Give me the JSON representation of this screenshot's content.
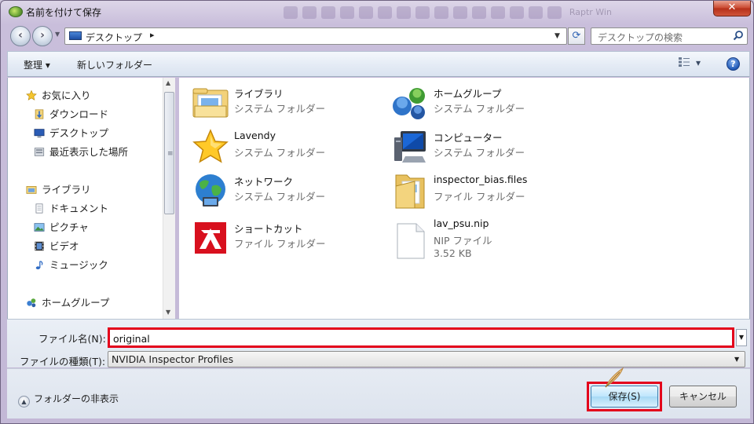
{
  "window": {
    "title": "名前を付けて保存",
    "close_label": "✕",
    "background_tabs": "Raptr Win"
  },
  "address": {
    "current": "デスクトップ",
    "separator": "▸",
    "search_placeholder": "デスクトップの検索"
  },
  "toolbar": {
    "organize": "整理 ▾",
    "new_folder": "新しいフォルダー",
    "view": "▾",
    "help": "?"
  },
  "nav": {
    "favorites": "お気に入り",
    "downloads": "ダウンロード",
    "desktop": "デスクトップ",
    "recent": "最近表示した場所",
    "libraries": "ライブラリ",
    "documents": "ドキュメント",
    "pictures": "ピクチャ",
    "videos": "ビデオ",
    "music": "ミュージック",
    "homegroup": "ホームグループ"
  },
  "files": [
    {
      "name": "ライブラリ",
      "type": "システム フォルダー",
      "icon": "library-folder-icon"
    },
    {
      "name": "ホームグループ",
      "type": "システム フォルダー",
      "icon": "homegroup-icon"
    },
    {
      "name": "Lavendy",
      "type": "システム フォルダー",
      "icon": "user-star-icon"
    },
    {
      "name": "コンピューター",
      "type": "システム フォルダー",
      "icon": "computer-icon"
    },
    {
      "name": "ネットワーク",
      "type": "システム フォルダー",
      "icon": "network-globe-icon"
    },
    {
      "name": "inspector_bias.files",
      "type": "ファイル フォルダー",
      "icon": "folder-icon"
    },
    {
      "name": "ショートカット",
      "type": "ファイル フォルダー",
      "icon": "shortcut-app-icon"
    },
    {
      "name": "lav_psu.nip",
      "type": "NIP ファイル",
      "size": "3.52 KB",
      "icon": "file-icon"
    }
  ],
  "form": {
    "filename_label": "ファイル名(N):",
    "filename_value": "original",
    "filetype_label": "ファイルの種類(T):",
    "filetype_value": "NVIDIA Inspector Profiles"
  },
  "footer": {
    "hide_folders": "フォルダーの非表示",
    "save": "保存(S)",
    "cancel": "キャンセル"
  },
  "colors": {
    "highlight": "#e3001b",
    "accent": "#3c7fb1"
  }
}
